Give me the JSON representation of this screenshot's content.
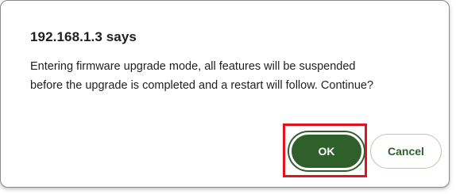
{
  "dialog": {
    "title": "192.168.1.3 says",
    "message_line1": "Entering firmware upgrade mode, all features will be suspended",
    "message_line2": "before the upgrade is completed and a restart will follow. Continue?",
    "ok_label": "OK",
    "cancel_label": "Cancel"
  },
  "colors": {
    "primary_button": "#2f5f2b",
    "highlight_border": "#e0141e",
    "text": "#1f1f1f"
  }
}
